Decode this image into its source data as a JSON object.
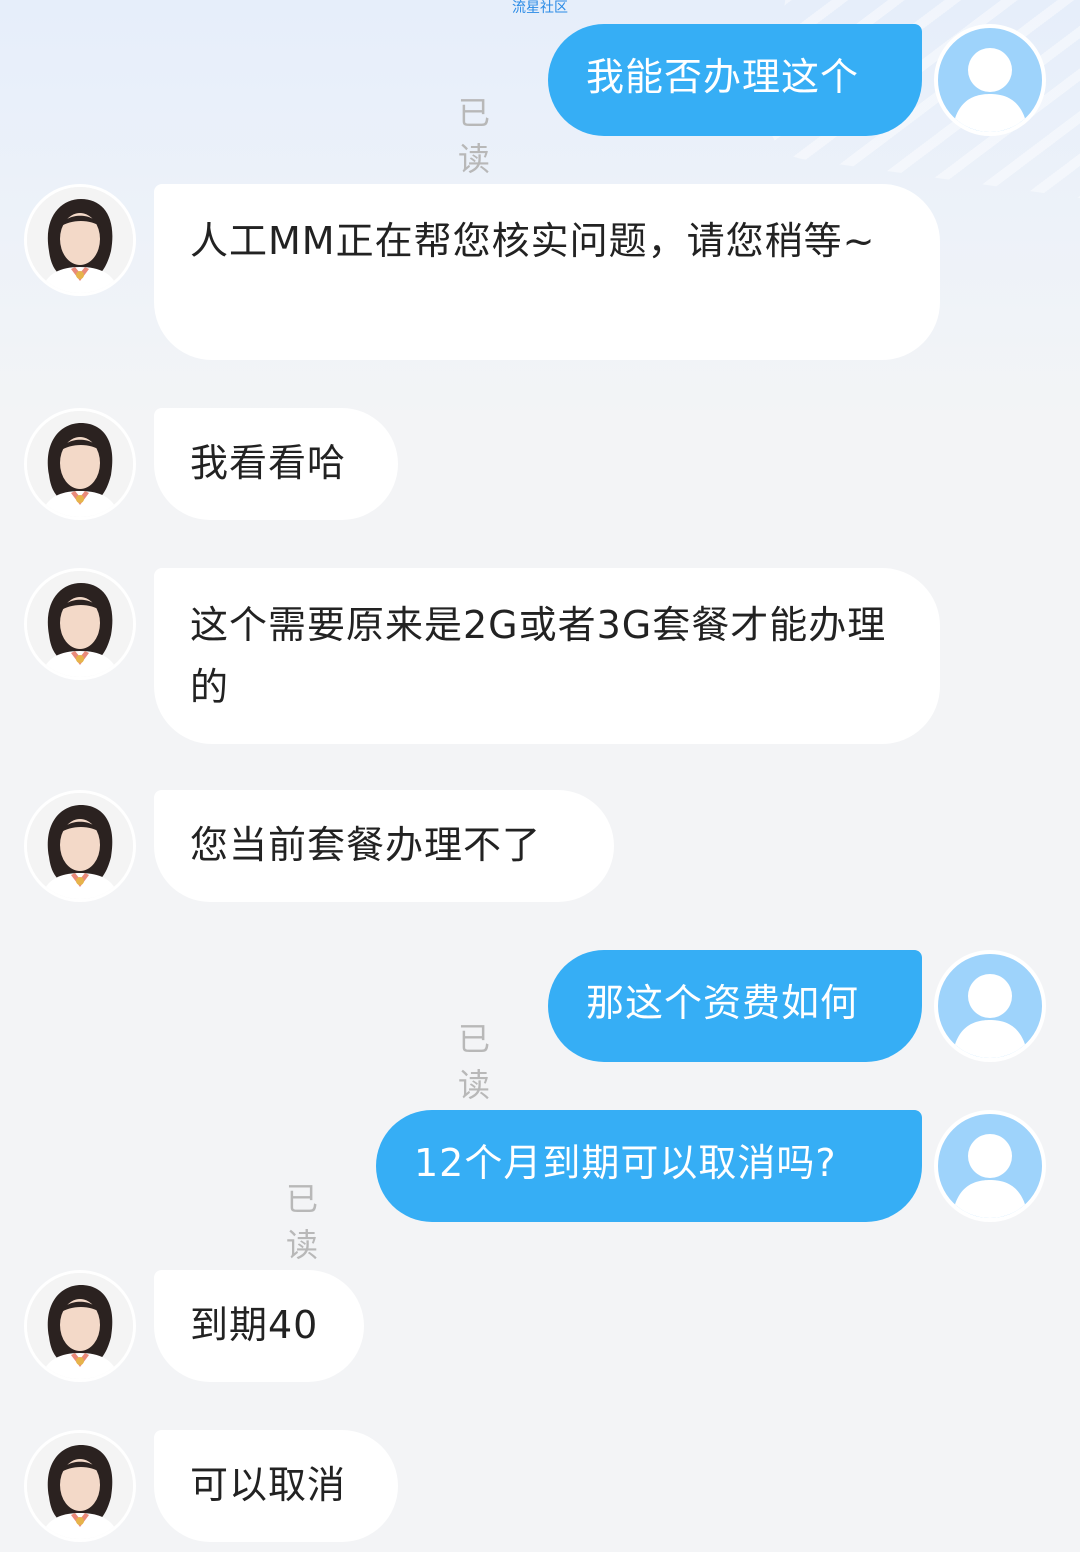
{
  "watermark": "流星社区",
  "colors": {
    "user_bubble": "#36aef5",
    "agent_bubble": "#ffffff",
    "read_receipt": "#b8b8b8",
    "background": "#f3f4f6"
  },
  "icons": {
    "user_avatar": "user-silhouette-icon",
    "agent_avatar": "agent-avatar-portrait"
  },
  "messages": [
    {
      "sender": "user",
      "text": "我能否办理这个",
      "status": "已读"
    },
    {
      "sender": "agent",
      "text": "人工MM正在帮您核实问题，请您稍等~"
    },
    {
      "sender": "agent",
      "text": "我看看哈"
    },
    {
      "sender": "agent",
      "text": "这个需要原来是2G或者3G套餐才能办理的"
    },
    {
      "sender": "agent",
      "text": "您当前套餐办理不了"
    },
    {
      "sender": "user",
      "text": "那这个资费如何",
      "status": "已读"
    },
    {
      "sender": "user",
      "text": "12个月到期可以取消吗?",
      "status": "已读"
    },
    {
      "sender": "agent",
      "text": "到期40"
    },
    {
      "sender": "agent",
      "text": "可以取消"
    }
  ]
}
